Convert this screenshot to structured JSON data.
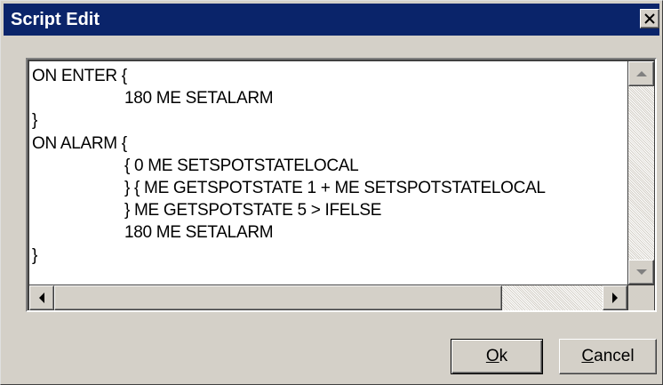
{
  "window": {
    "title": "Script Edit",
    "close_glyph": "✕",
    "titlebar_color": "#0a246a"
  },
  "editor": {
    "lines": [
      {
        "text": "ON ENTER {",
        "indent": false
      },
      {
        "text": "180 ME SETALARM",
        "indent": true
      },
      {
        "text": "}",
        "indent": false
      },
      {
        "text": "ON ALARM {",
        "indent": false
      },
      {
        "text": "{ 0 ME SETSPOTSTATELOCAL",
        "indent": true
      },
      {
        "text": "} { ME GETSPOTSTATE 1 + ME SETSPOTSTATELOCAL",
        "indent": true
      },
      {
        "text": "} ME GETSPOTSTATE 5 > IFELSE",
        "indent": true
      },
      {
        "text": "180 ME SETALARM",
        "indent": true
      },
      {
        "text": "}",
        "indent": false
      }
    ]
  },
  "buttons": {
    "ok": {
      "mnemonic": "O",
      "rest": "k"
    },
    "cancel": {
      "mnemonic": "C",
      "rest": "ancel"
    }
  }
}
